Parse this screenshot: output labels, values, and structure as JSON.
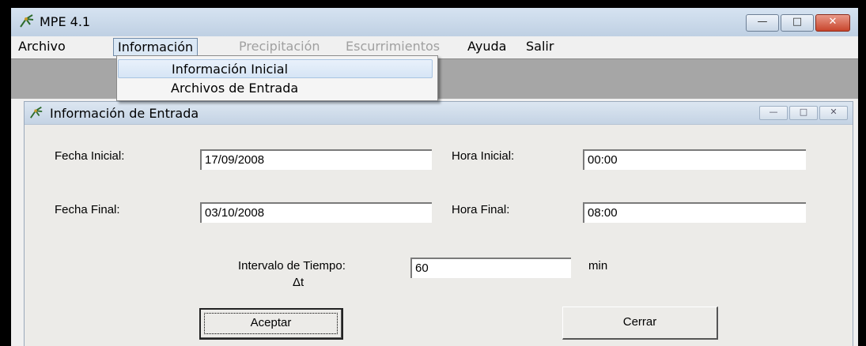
{
  "window": {
    "title": "MPE 4.1",
    "minimize_glyph": "—",
    "maximize_glyph": "□",
    "close_glyph": "✕"
  },
  "menubar": {
    "items": [
      {
        "label": "Archivo",
        "state": "normal"
      },
      {
        "label": "Información",
        "state": "open"
      },
      {
        "label": "Precipitación",
        "state": "disabled"
      },
      {
        "label": "Escurrimientos",
        "state": "disabled"
      },
      {
        "label": "Ayuda",
        "state": "normal"
      },
      {
        "label": "Salir",
        "state": "normal"
      }
    ]
  },
  "dropdown": {
    "items": [
      {
        "label": "Información Inicial",
        "highlighted": true
      },
      {
        "label": "Archivos de Entrada",
        "highlighted": false
      }
    ]
  },
  "child_window": {
    "title": "Información de Entrada",
    "minimize_glyph": "—",
    "maximize_glyph": "□",
    "close_glyph": "✕"
  },
  "form": {
    "fecha_inicial_label": "Fecha Inicial:",
    "fecha_inicial_value": "17/09/2008",
    "hora_inicial_label": "Hora Inicial:",
    "hora_inicial_value": "00:00",
    "fecha_final_label": "Fecha Final:",
    "fecha_final_value": "03/10/2008",
    "hora_final_label": "Hora Final:",
    "hora_final_value": "08:00",
    "intervalo_label": "Intervalo de Tiempo:",
    "intervalo_sublabel": "Δt",
    "intervalo_value": "60",
    "intervalo_unit": "min"
  },
  "buttons": {
    "aceptar": "Aceptar",
    "cerrar": "Cerrar"
  },
  "icons": {
    "app": "app-icon",
    "child": "app-icon"
  }
}
